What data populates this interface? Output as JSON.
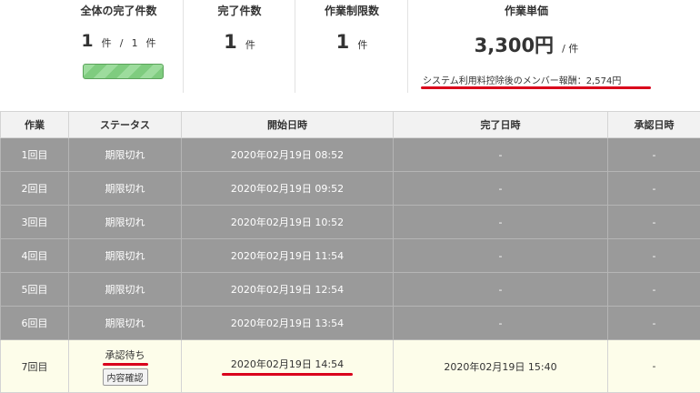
{
  "summary": {
    "total": {
      "label": "全体の完了件数",
      "done": "1",
      "unit1": "件",
      "sep": "/",
      "total": "1",
      "unit2": "件",
      "progress": 1.0
    },
    "completed": {
      "label": "完了件数",
      "value": "1",
      "unit": "件"
    },
    "limit": {
      "label": "作業制限数",
      "value": "1",
      "unit": "件"
    },
    "price": {
      "label": "作業単価",
      "value": "3,300円",
      "unit": "/ 件",
      "net": "システム利用料控除後のメンバー報酬：2,574円"
    }
  },
  "table": {
    "headers": [
      "作業",
      "ステータス",
      "開始日時",
      "完了日時",
      "承認日時"
    ],
    "rows": [
      {
        "task": "1回目",
        "status": "期限切れ",
        "start": "2020年02月19日 08:52",
        "end": "-",
        "approved": "-"
      },
      {
        "task": "2回目",
        "status": "期限切れ",
        "start": "2020年02月19日 09:52",
        "end": "-",
        "approved": "-"
      },
      {
        "task": "3回目",
        "status": "期限切れ",
        "start": "2020年02月19日 10:52",
        "end": "-",
        "approved": "-"
      },
      {
        "task": "4回目",
        "status": "期限切れ",
        "start": "2020年02月19日 11:54",
        "end": "-",
        "approved": "-"
      },
      {
        "task": "5回目",
        "status": "期限切れ",
        "start": "2020年02月19日 12:54",
        "end": "-",
        "approved": "-"
      },
      {
        "task": "6回目",
        "status": "期限切れ",
        "start": "2020年02月19日 13:54",
        "end": "-",
        "approved": "-"
      }
    ],
    "active_row": {
      "task": "7回目",
      "status": "承認待ち",
      "button": "内容確認",
      "start": "2020年02月19日 14:54",
      "end": "2020年02月19日 15:40",
      "approved": "-"
    }
  },
  "colors": {
    "expired_row": "#9a9a9a",
    "active_row": "#fdfdea",
    "highlight": "#d9001b",
    "progress": "#7fcc7f"
  }
}
